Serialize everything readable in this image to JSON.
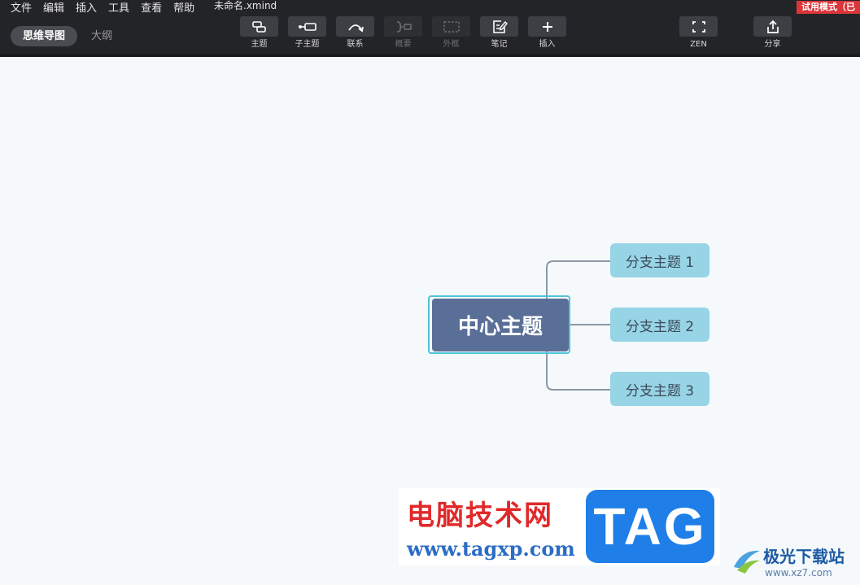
{
  "menu": [
    "文件",
    "编辑",
    "插入",
    "工具",
    "查看",
    "帮助"
  ],
  "file_name": "未命名.xmind",
  "trial_badge": "试用模式（已",
  "view_tabs": [
    {
      "label": "思维导图",
      "active": true
    },
    {
      "label": "大纲",
      "active": false
    }
  ],
  "toolbar": {
    "topic": "主题",
    "subtopic": "子主题",
    "relationship": "联系",
    "summary": "概要",
    "boundary": "外框",
    "notes": "笔记",
    "insert": "插入",
    "zen": "ZEN",
    "share": "分享"
  },
  "mindmap": {
    "central": "中心主题",
    "branches": [
      "分支主题 1",
      "分支主题 2",
      "分支主题 3"
    ]
  },
  "watermark": {
    "site_cn": "电脑技术网",
    "site_url": "www.tagxp.com",
    "tag": "TAG",
    "site2_cn": "极光下载站",
    "site2_url": "www.xz7.com"
  },
  "colors": {
    "toolbar_bg": "#232427",
    "canvas_bg": "#f5f9fc",
    "central_fill": "#5a6f97",
    "central_outline": "#4ec3d6",
    "branch_fill": "#96d4e6",
    "trial_badge": "#d9363a"
  }
}
